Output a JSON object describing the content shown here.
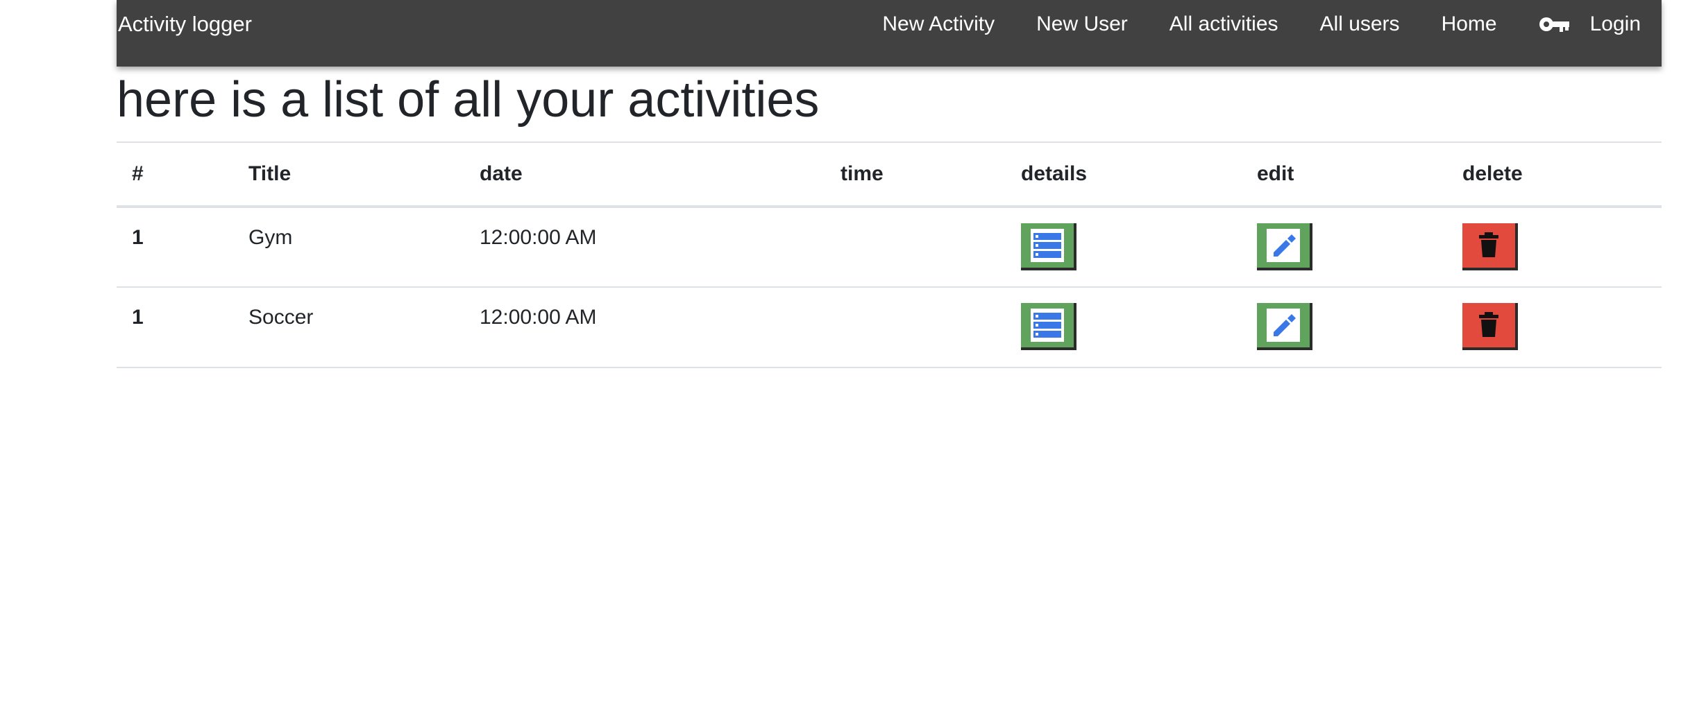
{
  "navbar": {
    "brand": "Activity logger",
    "links": [
      {
        "label": "New Activity"
      },
      {
        "label": "New User"
      },
      {
        "label": "All activities"
      },
      {
        "label": "All users"
      },
      {
        "label": "Home"
      }
    ],
    "login_label": "Login",
    "login_icon": "key-icon"
  },
  "page": {
    "heading": "here is a list of all your activities"
  },
  "table": {
    "headers": [
      "#",
      "Title",
      "date",
      "time",
      "details",
      "edit",
      "delete"
    ],
    "rows": [
      {
        "num": "1",
        "title": "Gym",
        "date": "12:00:00 AM",
        "time": ""
      },
      {
        "num": "1",
        "title": "Soccer",
        "date": "12:00:00 AM",
        "time": ""
      }
    ],
    "icons": {
      "details": "list-icon",
      "edit": "pencil-icon",
      "delete": "trash-icon"
    }
  },
  "colors": {
    "navbar_bg": "#414141",
    "details_edit_button": "#5fa35c",
    "delete_button": "#e14a3c",
    "icon_blue": "#3b78e7"
  }
}
